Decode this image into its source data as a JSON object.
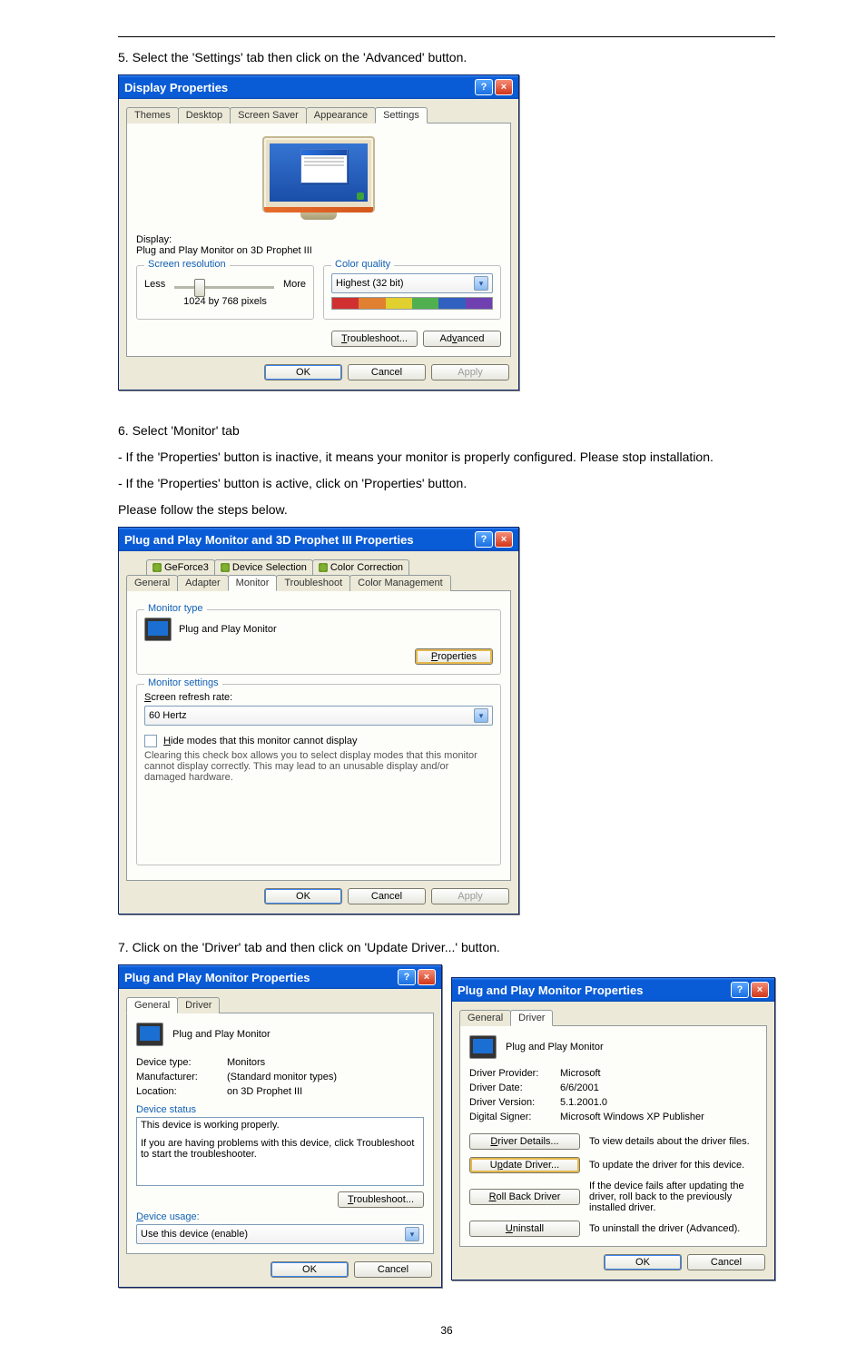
{
  "instructions": {
    "step5": "5. Select the 'Settings' tab then click on the 'Advanced' button.",
    "step6a": "6. Select 'Monitor' tab",
    "step6b": "- If the 'Properties' button is inactive, it means your monitor is properly configured. Please stop installation.",
    "step6c": "- If the 'Properties' button is active, click on 'Properties' button.",
    "step6d": "Please follow the steps below.",
    "step7": "7. Click on the 'Driver' tab and then click on 'Update Driver...' button."
  },
  "dlg1": {
    "title": "Display Properties",
    "tabs": [
      "Themes",
      "Desktop",
      "Screen Saver",
      "Appearance",
      "Settings"
    ],
    "display_label": "Display:",
    "display_value": "Plug and Play Monitor on 3D Prophet III",
    "screen_res": {
      "legend": "Screen resolution",
      "less": "Less",
      "more": "More",
      "value": "1024 by 768 pixels"
    },
    "color_quality": {
      "legend": "Color quality",
      "value": "Highest (32 bit)"
    },
    "btn_troubleshoot": "Troubleshoot...",
    "btn_advanced": "Advanced",
    "btn_ok": "OK",
    "btn_cancel": "Cancel",
    "btn_apply": "Apply"
  },
  "dlg2": {
    "title": "Plug and Play Monitor and 3D Prophet III Properties",
    "tabs_row1": [
      "GeForce3",
      "Device Selection",
      "Color Correction"
    ],
    "tabs_row2": [
      "General",
      "Adapter",
      "Monitor",
      "Troubleshoot",
      "Color Management"
    ],
    "monitor_type": {
      "legend": "Monitor type",
      "name": "Plug and Play Monitor",
      "btn_properties": "Properties"
    },
    "monitor_settings": {
      "legend": "Monitor settings",
      "refresh_label": "Screen refresh rate:",
      "refresh_value": "60 Hertz",
      "hide_modes": "Hide modes that this monitor cannot display",
      "hide_modes_desc": "Clearing this check box allows you to select display modes that this monitor cannot display correctly. This may lead to an unusable display and/or damaged hardware."
    },
    "btn_ok": "OK",
    "btn_cancel": "Cancel",
    "btn_apply": "Apply"
  },
  "dlg3": {
    "title": "Plug and Play Monitor Properties",
    "tabs": [
      "General",
      "Driver"
    ],
    "monitor_name": "Plug and Play Monitor",
    "device_type_lbl": "Device type:",
    "device_type_val": "Monitors",
    "manufacturer_lbl": "Manufacturer:",
    "manufacturer_val": "(Standard monitor types)",
    "location_lbl": "Location:",
    "location_val": "on 3D Prophet III",
    "device_status_lbl": "Device status",
    "device_status_val": "This device is working properly.",
    "device_status_help": "If you are having problems with this device, click Troubleshoot to start the troubleshooter.",
    "btn_troubleshoot": "Troubleshoot...",
    "device_usage_lbl": "Device usage:",
    "device_usage_val": "Use this device (enable)",
    "btn_ok": "OK",
    "btn_cancel": "Cancel"
  },
  "dlg4": {
    "title": "Plug and Play Monitor Properties",
    "tabs": [
      "General",
      "Driver"
    ],
    "monitor_name": "Plug and Play Monitor",
    "provider_lbl": "Driver Provider:",
    "provider_val": "Microsoft",
    "date_lbl": "Driver Date:",
    "date_val": "6/6/2001",
    "version_lbl": "Driver Version:",
    "version_val": "5.1.2001.0",
    "signer_lbl": "Digital Signer:",
    "signer_val": "Microsoft Windows XP Publisher",
    "btn_details": "Driver Details...",
    "btn_details_desc": "To view details about the driver files.",
    "btn_update": "Update Driver...",
    "btn_update_desc": "To update the driver for this device.",
    "btn_rollback": "Roll Back Driver",
    "btn_rollback_desc": "If the device fails after updating the driver, roll back to the previously installed driver.",
    "btn_uninstall": "Uninstall",
    "btn_uninstall_desc": "To uninstall the driver (Advanced).",
    "btn_ok": "OK",
    "btn_cancel": "Cancel"
  },
  "page_number": "36"
}
